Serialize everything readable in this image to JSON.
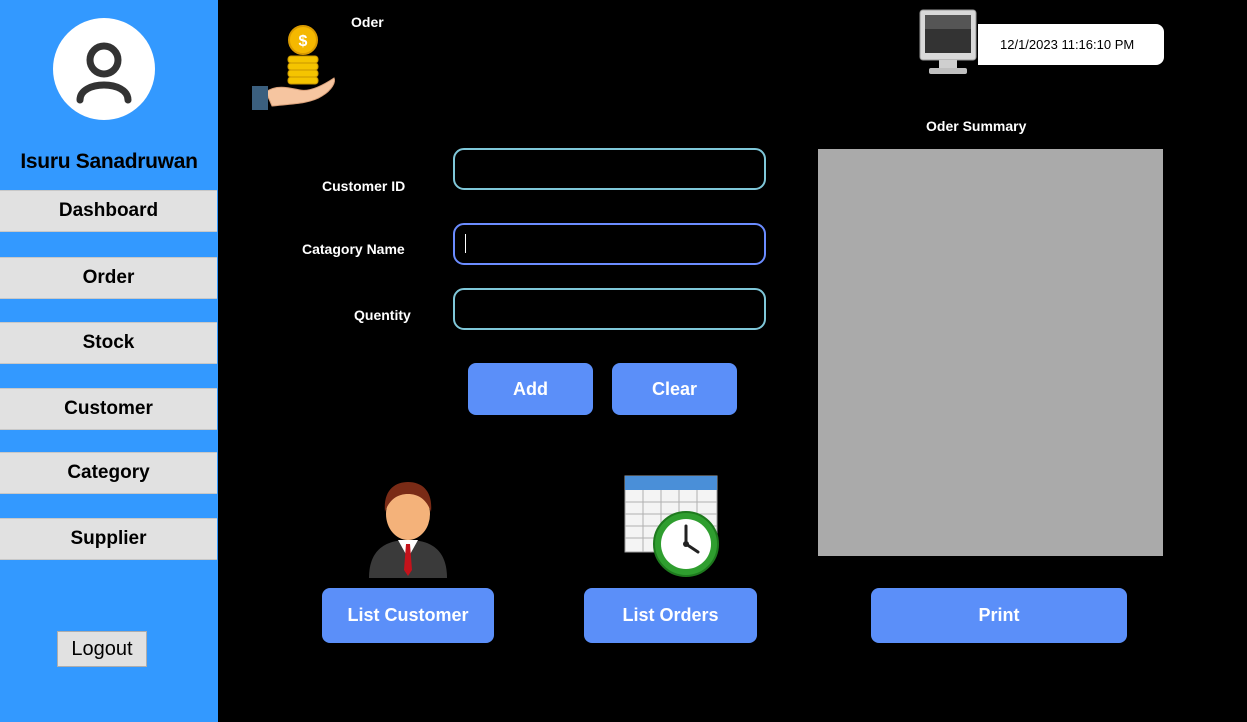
{
  "sidebar": {
    "user_name": "Isuru Sanadruwan",
    "nav": [
      "Dashboard",
      "Order",
      "Stock",
      "Customer",
      "Category",
      "Supplier"
    ],
    "logout_label": "Logout",
    "background_color": "#3399ff"
  },
  "header": {
    "title": "Oder",
    "datetime": "12/1/2023 11:16:10 PM"
  },
  "form": {
    "customer_id_label": "Customer ID",
    "category_name_label": "Catagory Name",
    "quantity_label": "Quentity",
    "customer_id_value": "",
    "category_name_value": "",
    "quantity_value": "",
    "add_label": "Add",
    "clear_label": "Clear"
  },
  "summary": {
    "title": "Oder Summary",
    "print_label": "Print"
  },
  "actions": {
    "list_customer_label": "List Customer",
    "list_orders_label": "List Orders"
  },
  "icons": {
    "avatar": "user-icon",
    "header": "hand-coins-icon",
    "datetime": "monitor-icon",
    "list_customer": "businessman-icon",
    "list_orders": "calendar-clock-icon"
  },
  "colors": {
    "accent": "#5b8ff9",
    "field_border": "#7fc7d9",
    "field_focus_border": "#6b8cff",
    "summary_bg": "#aaaaaa"
  }
}
